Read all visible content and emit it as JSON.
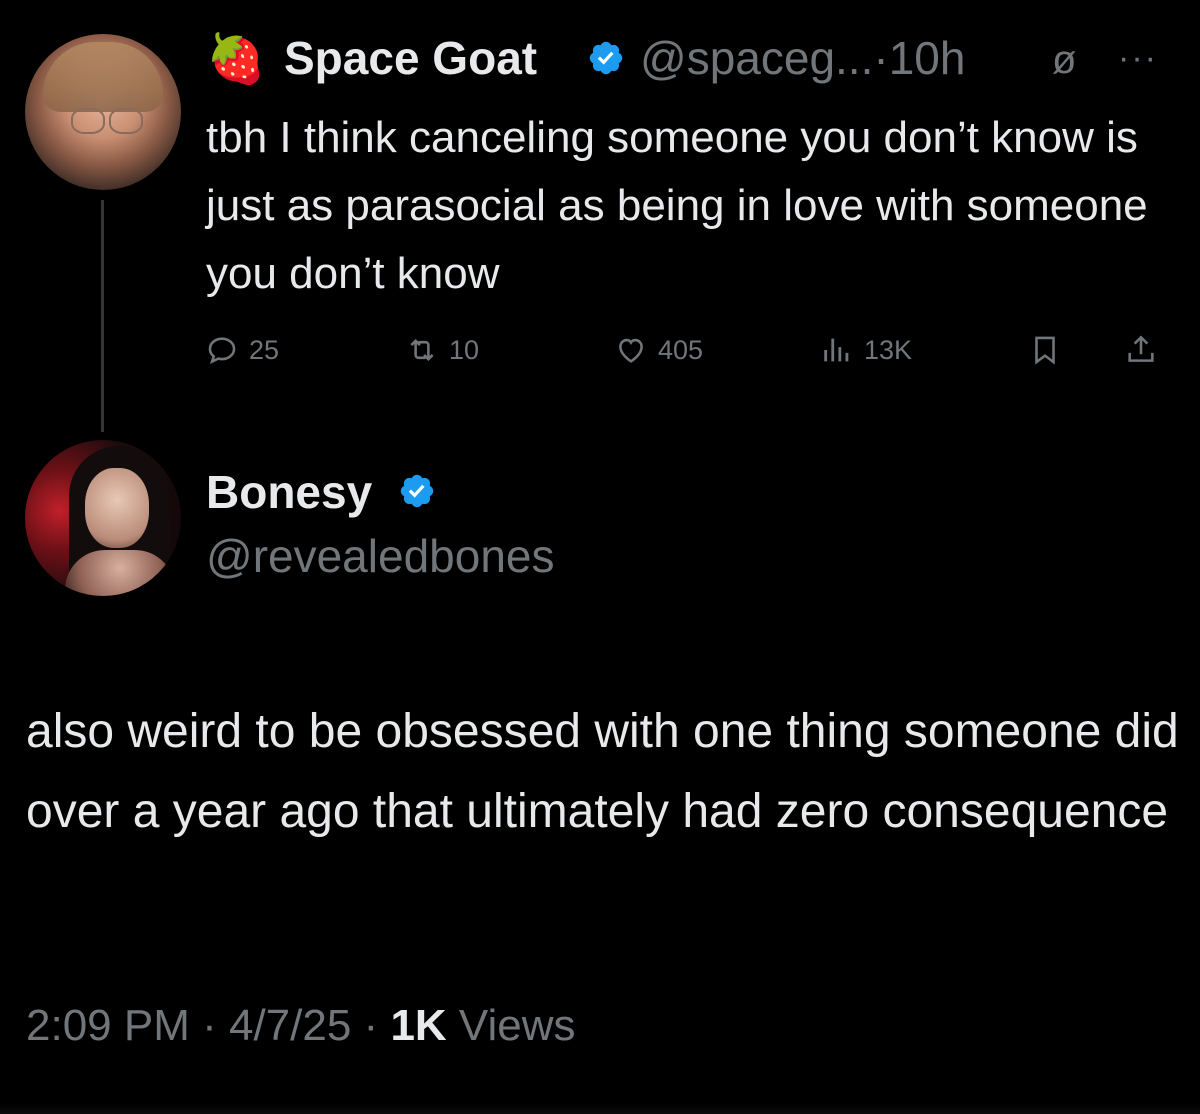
{
  "tweet_1": {
    "author": {
      "emoji": "🍓",
      "name": "Space Goat",
      "handle": "@spaceg...",
      "time": "·10h"
    },
    "header_icons": [
      "null-set-icon",
      "more-icon"
    ],
    "null_symbol": "ø",
    "more_symbol": "···",
    "text": "tbh I think canceling someone you don’t know is just as parasocial as being in love with someone you don’t know",
    "actions": {
      "replies": "25",
      "reposts": "10",
      "likes": "405",
      "views": "13K"
    }
  },
  "tweet_2": {
    "author": {
      "name": "Bonesy",
      "handle": "@revealedbones"
    },
    "text": "also weird to be obsessed with one thing someone did over a year ago that ultimately had zero consequence",
    "meta": {
      "time": "2:09 PM",
      "sep1": " · ",
      "date": "4/7/25",
      "sep2": " · ",
      "views_count": "1K",
      "views_label": " Views"
    }
  },
  "colors": {
    "background": "#000000",
    "text": "#e7e9ea",
    "muted": "#71767b",
    "verified": "#1d9bf0",
    "thread_line": "#333639"
  }
}
